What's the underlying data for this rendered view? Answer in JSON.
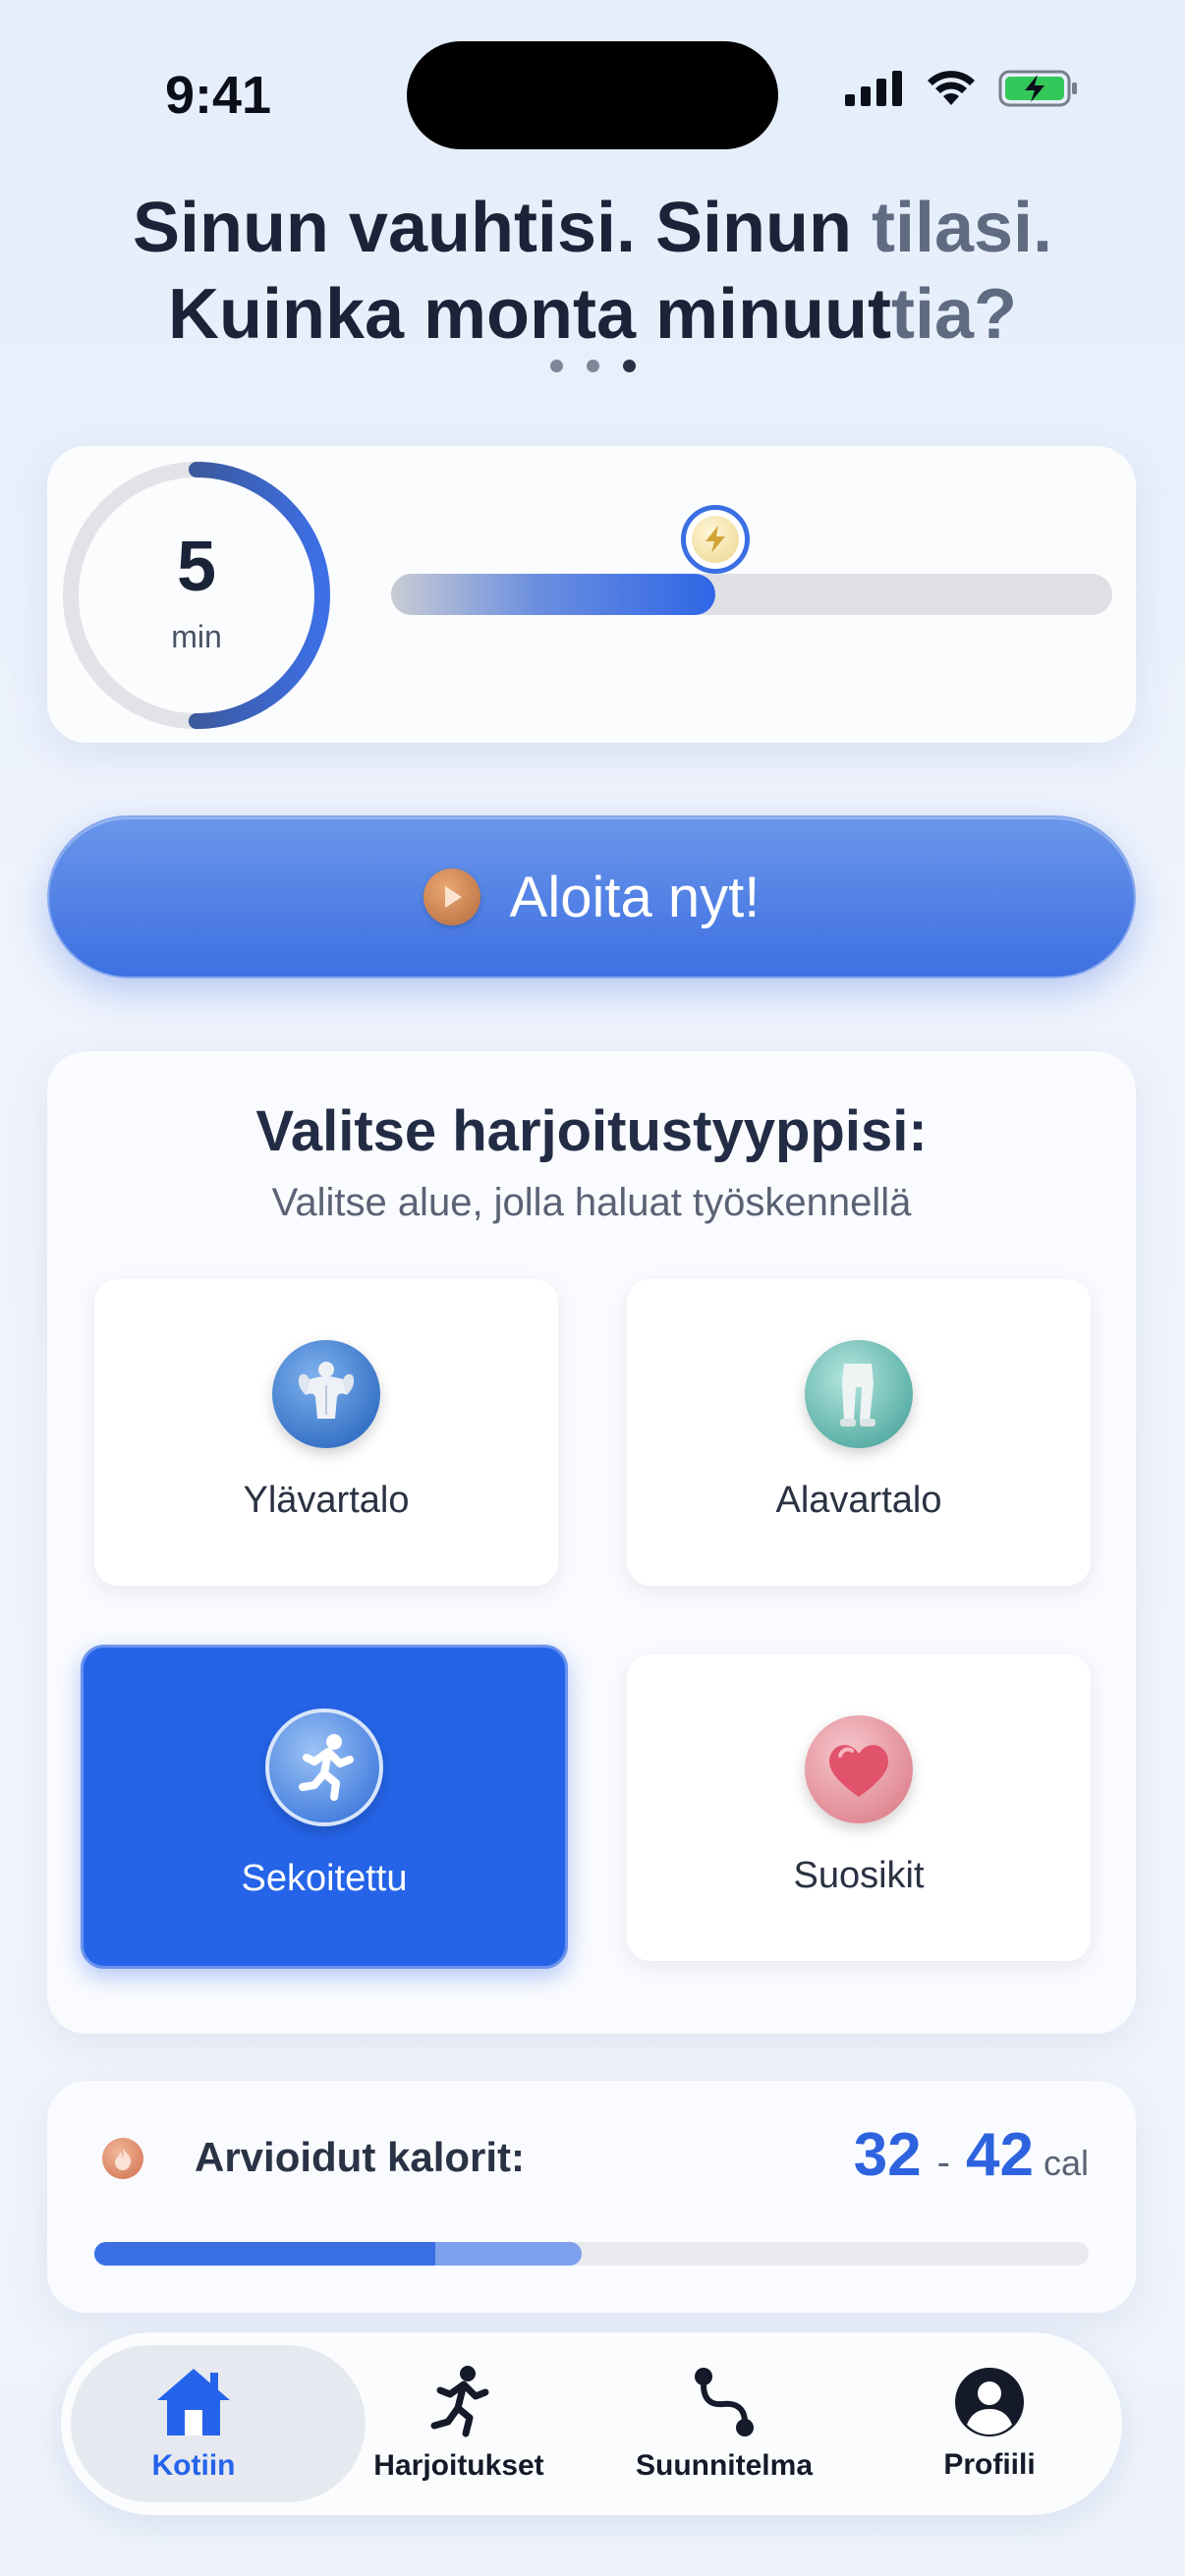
{
  "status_bar": {
    "time": "9:41"
  },
  "header": {
    "line1_main": "Sinun vauhtisi. Sinun ",
    "line1_fade": "tilasi.",
    "line2_main": "Kuinka monta minuut",
    "line2_fade": "tia?"
  },
  "page_indicator": {
    "count": 3,
    "active_index": 2
  },
  "duration": {
    "value": "5",
    "unit": "min",
    "ring_progress": 0.5,
    "slider_progress": 0.45,
    "thumb_icon": "bolt-icon"
  },
  "start_button": {
    "label": "Aloita nyt!",
    "icon": "play-icon"
  },
  "workout_types": {
    "title": "Valitse harjoitustyyppisi:",
    "subtitle": "Valitse alue, jolla haluat työskennellä",
    "options": [
      {
        "label": "Ylävartalo",
        "icon": "upper-body-icon",
        "selected": false
      },
      {
        "label": "Alavartalo",
        "icon": "lower-body-icon",
        "selected": false
      },
      {
        "label": "Sekoitettu",
        "icon": "running-icon",
        "selected": true
      },
      {
        "label": "Suosikit",
        "icon": "heart-icon",
        "selected": false
      }
    ]
  },
  "calories": {
    "label": "Arvioidut kalorit:",
    "min": "32",
    "separator": "-",
    "max": "42",
    "unit": "cal",
    "progress": 0.49,
    "icon": "flame-icon"
  },
  "tab_bar": {
    "tabs": [
      {
        "label": "Kotiin",
        "icon": "home-icon",
        "active": true
      },
      {
        "label": "Harjoitukset",
        "icon": "runner-icon",
        "active": false
      },
      {
        "label": "Suunnitelma",
        "icon": "route-icon",
        "active": false
      },
      {
        "label": "Profiili",
        "icon": "profile-icon",
        "active": false
      }
    ]
  },
  "colors": {
    "accent": "#2564e8",
    "title": "#1b2338",
    "background": "#eef3fc"
  }
}
